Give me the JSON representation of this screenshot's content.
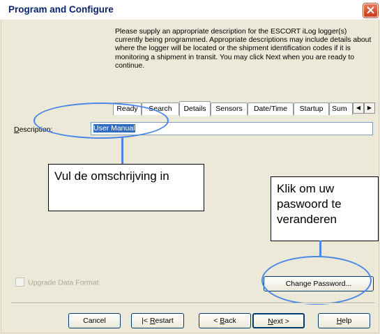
{
  "window": {
    "title": "Program and Configure"
  },
  "instructions": "Please supply an appropriate description for the ESCORT iLog logger(s) currently being programmed. Appropriate descriptions may include details about where the logger will be located or the shipment identification codes if it is monitoring a shipment in transit. You may click Next when you are ready to continue.",
  "tabs": [
    {
      "label": "Ready"
    },
    {
      "label": "Search"
    },
    {
      "label": "Details",
      "active": true
    },
    {
      "label": "Sensors"
    },
    {
      "label": "Date/Time"
    },
    {
      "label": "Startup"
    },
    {
      "label": "Sum"
    }
  ],
  "description": {
    "label_accel": "D",
    "label_rest": "escription:",
    "value": "User Manual"
  },
  "callouts": {
    "description": "Vul de omschrijving in",
    "password": "Klik om uw paswoord te veranderen"
  },
  "upgrade": {
    "label": "Upgrade Data Format",
    "checked": false,
    "enabled": false
  },
  "buttons": {
    "change_password": "Change Password...",
    "cancel": "Cancel",
    "restart_prefix": "|< ",
    "restart_accel": "R",
    "restart_rest": "estart",
    "back_prefix": "< ",
    "back_accel": "B",
    "back_rest": "ack",
    "next_accel": "N",
    "next_rest": "ext >",
    "help_accel": "H",
    "help_rest": "elp"
  },
  "colors": {
    "title_text": "#0a246a",
    "annotation_blue": "#4a86e8",
    "close_button": "#c43b1d"
  }
}
